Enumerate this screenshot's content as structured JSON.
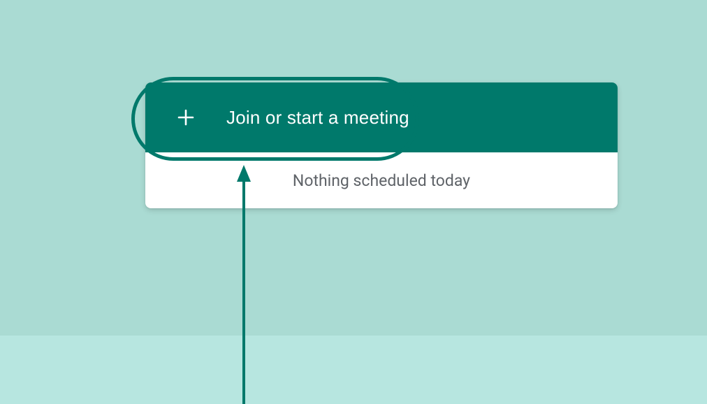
{
  "card": {
    "join_button_label": "Join or start a meeting",
    "schedule_text": "Nothing scheduled today"
  },
  "icons": {
    "plus": "plus-icon"
  }
}
